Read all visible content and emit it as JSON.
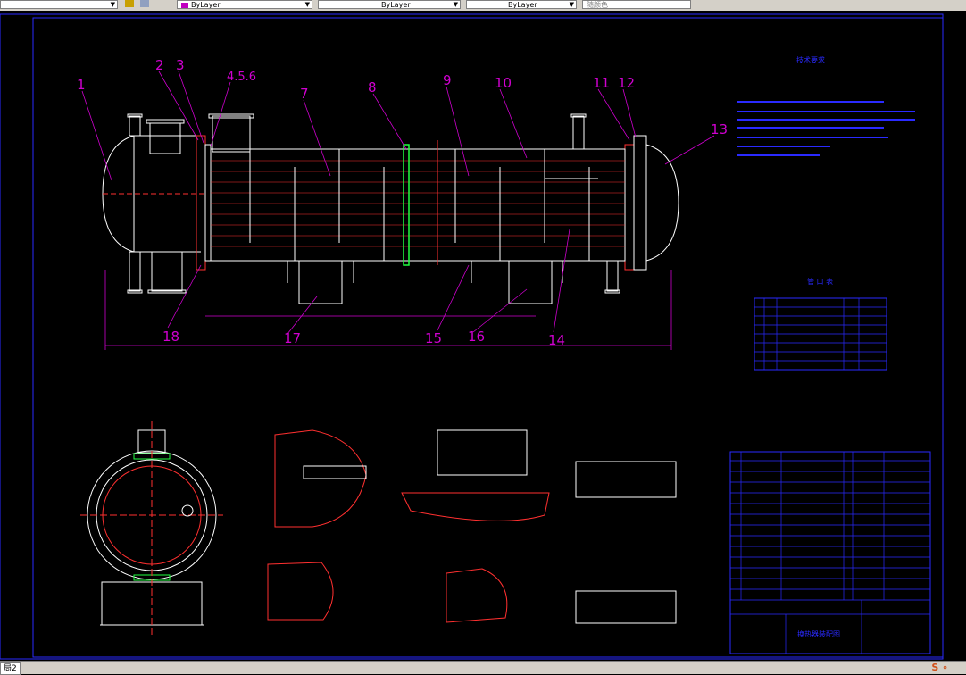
{
  "toolbar": {
    "layer_value": "ByLayer",
    "linetype_value": "ByLayer",
    "lineweight_value": "ByLayer",
    "plotstyle_value": "随颜色"
  },
  "drawing": {
    "title": "技术要求",
    "nozzle_table_title": "管 口 表",
    "title_block_name": "换热器装配图",
    "leader_labels": [
      "1",
      "2",
      "3",
      "4.5.6",
      "7",
      "8",
      "9",
      "10",
      "11",
      "12",
      "13",
      "14",
      "15",
      "16",
      "17",
      "18"
    ]
  },
  "status": {
    "layout_tab": "局2"
  },
  "colors": {
    "frame": "#2a2aff",
    "outline": "#ffffff",
    "section": "#ff3030",
    "leader": "#d000d0",
    "text_red": "#ff4040",
    "text_cyan": "#00e0e0",
    "green": "#20ff40",
    "yellow": "#ffff00"
  }
}
